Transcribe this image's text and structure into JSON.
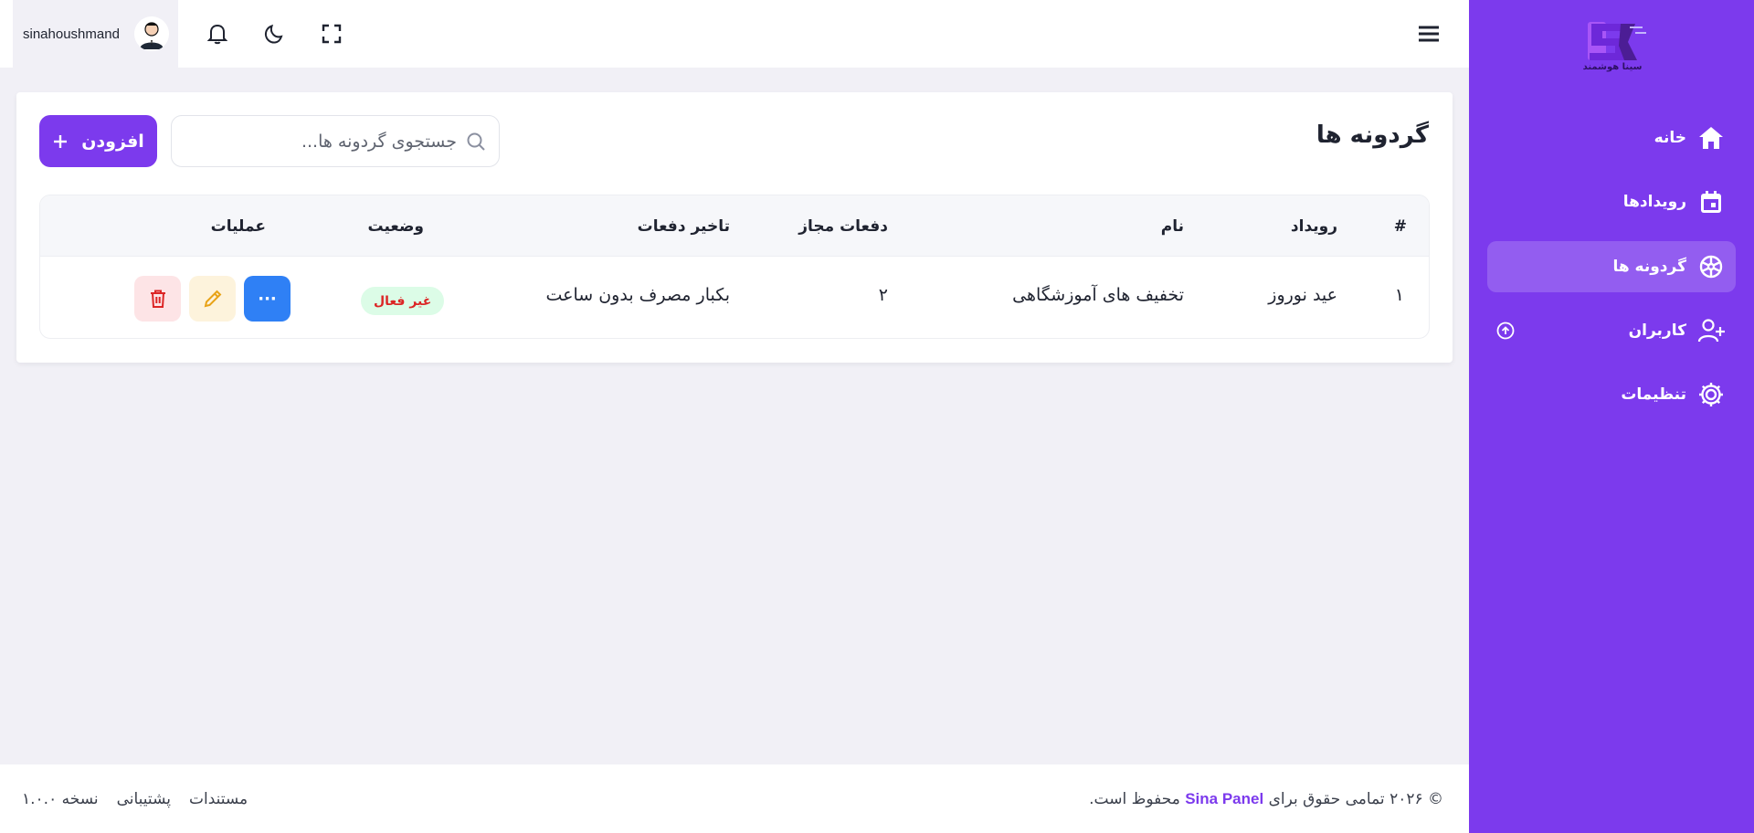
{
  "sidebar": {
    "logo_text": "سینا هوشمند",
    "items": [
      {
        "label": "خانه",
        "icon": "home-icon"
      },
      {
        "label": "رویدادها",
        "icon": "calendar-icon"
      },
      {
        "label": "گردونه ها",
        "icon": "wheel-icon",
        "active": true
      },
      {
        "label": "کاربران",
        "icon": "user-plus-icon"
      },
      {
        "label": "تنظیمات",
        "icon": "gear-icon"
      }
    ]
  },
  "header": {
    "username": "sinahoushmand"
  },
  "page": {
    "title": "گردونه ها",
    "add_label": "افزودن",
    "search_placeholder": "جستجوی گردونه ها..."
  },
  "table": {
    "columns": [
      "#",
      "رویداد",
      "نام",
      "دفعات مجاز",
      "تاخیر دفعات",
      "وضعیت",
      "عملیات"
    ],
    "rows": [
      {
        "index": "۱",
        "event": "عید نوروز",
        "name": "تخفیف های آموزشگاهی",
        "allowed": "۲",
        "delay": "بکبار مصرف بدون ساعت",
        "status": "غیر فعال",
        "more": "···"
      }
    ]
  },
  "footer": {
    "copyright_prefix": "© ۲۰۲۶ تمامی حقوق برای",
    "brand": "Sina Panel",
    "copyright_suffix": "محفوظ است.",
    "links": [
      "مستندات",
      "پشتیبانی",
      "نسخه ۱.۰.۰"
    ]
  },
  "colors": {
    "primary": "#7c3aed",
    "background": "#f1f0f6",
    "status_bg": "#dcfce7",
    "status_text": "#dc2626",
    "more_button": "#2f80f5"
  }
}
